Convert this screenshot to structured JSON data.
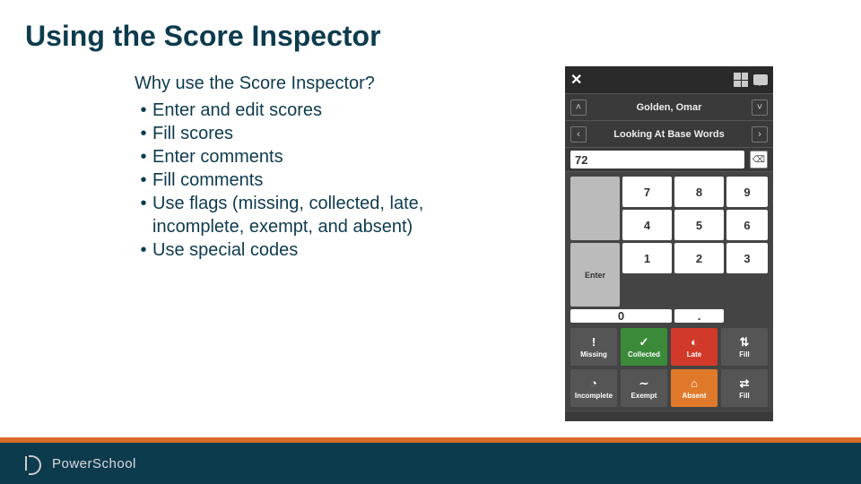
{
  "title": "Using the Score Inspector",
  "lead": "Why use the Score Inspector?",
  "bullets": [
    "Enter and edit scores",
    "Fill scores",
    "Enter comments",
    "Fill comments",
    "Use flags (missing, collected, late, incomplete, exempt, and absent)",
    "Use special codes"
  ],
  "inspector": {
    "student": "Golden, Omar",
    "assignment": "Looking At Base Words",
    "score": "72",
    "keypad": {
      "r1": [
        "7",
        "8",
        "9"
      ],
      "r2": [
        "4",
        "5",
        "6"
      ],
      "r3": [
        "1",
        "2",
        "3"
      ],
      "zero": "0",
      "dot": ".",
      "side_top": "",
      "side_enter": "Enter"
    },
    "flags": {
      "missing": "Missing",
      "collected": "Collected",
      "late": "Late",
      "fill_v": "Fill",
      "incomplete": "Incomplete",
      "exempt": "Exempt",
      "absent": "Absent",
      "fill_h": "Fill"
    }
  },
  "footer": {
    "brand": "PowerSchool"
  },
  "colors": {
    "title": "#0d3b4e",
    "footer": "#0d3b4e",
    "accent": "#d86b2a"
  }
}
